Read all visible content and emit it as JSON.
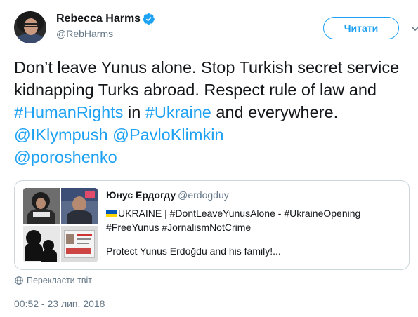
{
  "author": {
    "display_name": "Rebecca Harms",
    "handle": "@RebHarms",
    "verified": true,
    "avatar_icon": "profile-photo"
  },
  "follow_button": {
    "label": "Читати"
  },
  "tweet": {
    "segments": [
      {
        "text": "Don’t leave Yunus alone. Stop Turkish secret service kidnapping Turks abroad. Respect rule of law and ",
        "link": false
      },
      {
        "text": "#HumanRights",
        "link": true
      },
      {
        "text": " in ",
        "link": false
      },
      {
        "text": "#Ukraine",
        "link": true
      },
      {
        "text": " and everywhere. ",
        "link": false
      },
      {
        "text": "@IKlympush",
        "link": true
      },
      {
        "text": " ",
        "link": false
      },
      {
        "text": "@PavloKlimkin",
        "link": true
      },
      {
        "text": " ",
        "link": false
      },
      {
        "text": "@poroshenko",
        "link": true
      }
    ]
  },
  "quoted_tweet": {
    "name": "Юнус Ердогду",
    "handle": "@erdogduy",
    "line1": "UKRAINE | #DontLeaveYunusAlone - #UkraineOpening",
    "line2": "#FreeYunus #JornalismNotCrime",
    "line3": "Protect Yunus Erdoğdu and his family!...",
    "flag_icon": "ukraine-flag-icon"
  },
  "translate_label": "Перекласти твіт",
  "timestamp": "00:52 - 23 лип. 2018",
  "colors": {
    "accent": "#1da1f2",
    "secondary_text": "#657786",
    "border": "#ccd6dd"
  }
}
